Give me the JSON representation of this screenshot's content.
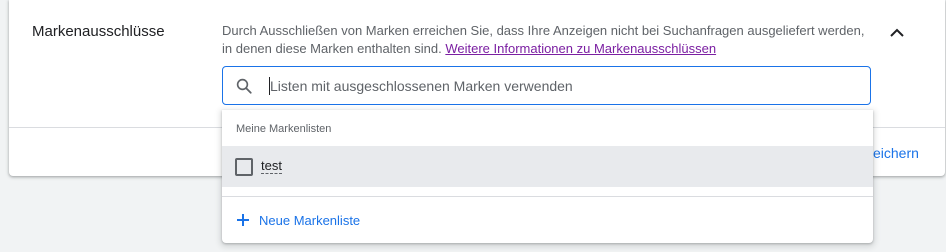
{
  "section": {
    "title": "Markenausschlüsse",
    "description": "Durch Ausschließen von Marken erreichen Sie, dass Ihre Anzeigen nicht bei Suchanfragen ausgeliefert werden, in denen diese Marken enthalten sind.",
    "link_text": "Weitere Informationen zu Markenausschlüssen",
    "collapse_icon": "chevron-up-icon"
  },
  "search": {
    "icon": "search-icon",
    "value": "",
    "placeholder": "Listen mit ausgeschlossenen Marken verwenden"
  },
  "dropdown": {
    "header": "Meine Markenlisten",
    "items": [
      {
        "label": "test",
        "checked": false
      }
    ],
    "new_list_label": "Neue Markenliste",
    "new_list_icon": "plus-icon"
  },
  "footer": {
    "save_partial_label": "eichern"
  },
  "colors": {
    "accent": "#1a73e8",
    "link_visited": "#7b1fa2",
    "hover_row": "#e8eaed",
    "background": "#f1f3f4"
  }
}
